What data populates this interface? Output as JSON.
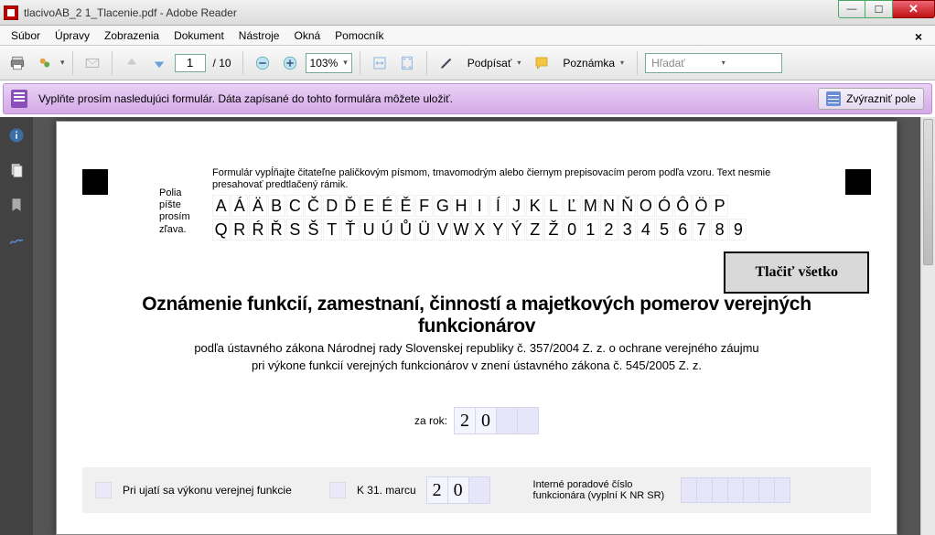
{
  "window": {
    "title": "tlacivoAB_2 1_Tlacenie.pdf - Adobe Reader"
  },
  "menu": {
    "items": [
      "Súbor",
      "Úpravy",
      "Zobrazenia",
      "Dokument",
      "Nástroje",
      "Okná",
      "Pomocník"
    ]
  },
  "toolbar": {
    "page_current": "1",
    "page_total": "/ 10",
    "zoom": "103%",
    "sign": "Podpísať",
    "note": "Poznámka",
    "search_placeholder": "Hľadať"
  },
  "notice": {
    "text": "Vyplňte prosím nasledujúci formulár. Dáta zapísané do tohto formulára môžete uložiť.",
    "highlight_btn": "Zvýrazniť pole"
  },
  "form": {
    "instr_top": "Formulár vypĺňajte čitateľne paličkovým  písmom, tmavomodrým alebo čiernym prepisovacím perom podľa vzoru. Text nesmie presahovať predtlačený rámik.",
    "instr_side": "Polia\npíšte\nprosím\nzľava.",
    "char_row1": [
      "A",
      "Á",
      "Ä",
      "B",
      "C",
      "Č",
      "D",
      "Ď",
      "E",
      "É",
      "Ě",
      "F",
      "G",
      "H",
      "I",
      "Í",
      "J",
      "K",
      "L",
      "Ľ",
      "M",
      "N",
      "Ň",
      "O",
      "Ó",
      "Ô",
      "Ö",
      "P"
    ],
    "char_row2": [
      "Q",
      "R",
      "Ŕ",
      "Ř",
      "S",
      "Š",
      "T",
      "Ť",
      "U",
      "Ú",
      "Ů",
      "Ü",
      "V",
      "W",
      "X",
      "Y",
      "Ý",
      "Z",
      "Ž",
      "0",
      "1",
      "2",
      "3",
      "4",
      "5",
      "6",
      "7",
      "8",
      "9"
    ],
    "print_btn": "Tlačiť všetko",
    "title": "Oznámenie funkcií, zamestnaní, činností a majetkových pomerov verejných funkcionárov",
    "subtitle1": "podľa ústavného zákona Národnej rady Slovenskej republiky č. 357/2004 Z. z. o ochrane verejného záujmu",
    "subtitle2": "pri výkone funkcií verejných funkcionárov v znení ústavného zákona č. 545/2005 Z. z.",
    "year_label": "za rok:",
    "year_digits": [
      "2",
      "0",
      "",
      ""
    ],
    "chk1_label": "Pri ujatí sa výkonu verejnej funkcie",
    "chk2_label": "K  31. marcu",
    "march_digits": [
      "2",
      "0",
      ""
    ],
    "intern_label": "Interné poradové číslo funkcionára (vyplní K NR SR)"
  }
}
